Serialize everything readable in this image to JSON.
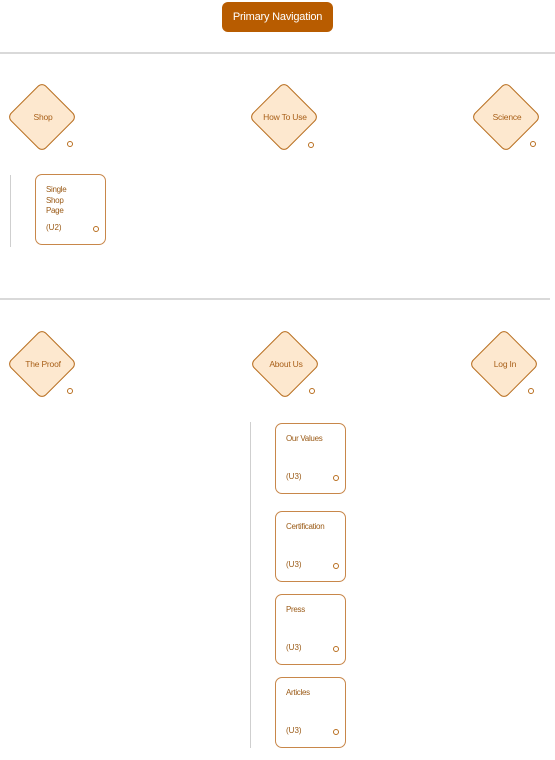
{
  "header": {
    "title": "Primary Navigation"
  },
  "colors": {
    "accent": "#b85c00",
    "node_fill": "#fde8cf",
    "node_border": "#b86e1f",
    "text": "#a85f18",
    "divider": "#d9d9d9"
  },
  "rows": [
    {
      "nodes": [
        {
          "label": "Shop",
          "children": [
            {
              "title": "Single Shop Page",
              "code": "(U2)"
            }
          ]
        },
        {
          "label": "How To Use",
          "children": []
        },
        {
          "label": "Science",
          "children": []
        }
      ]
    },
    {
      "nodes": [
        {
          "label": "The Proof",
          "children": []
        },
        {
          "label": "About Us",
          "children": [
            {
              "title": "Our Values",
              "code": "(U3)"
            },
            {
              "title": "Certification",
              "code": "(U3)"
            },
            {
              "title": "Press",
              "code": "(U3)"
            },
            {
              "title": "Articles",
              "code": "(U3)"
            }
          ]
        },
        {
          "label": "Log In",
          "children": []
        }
      ]
    }
  ]
}
